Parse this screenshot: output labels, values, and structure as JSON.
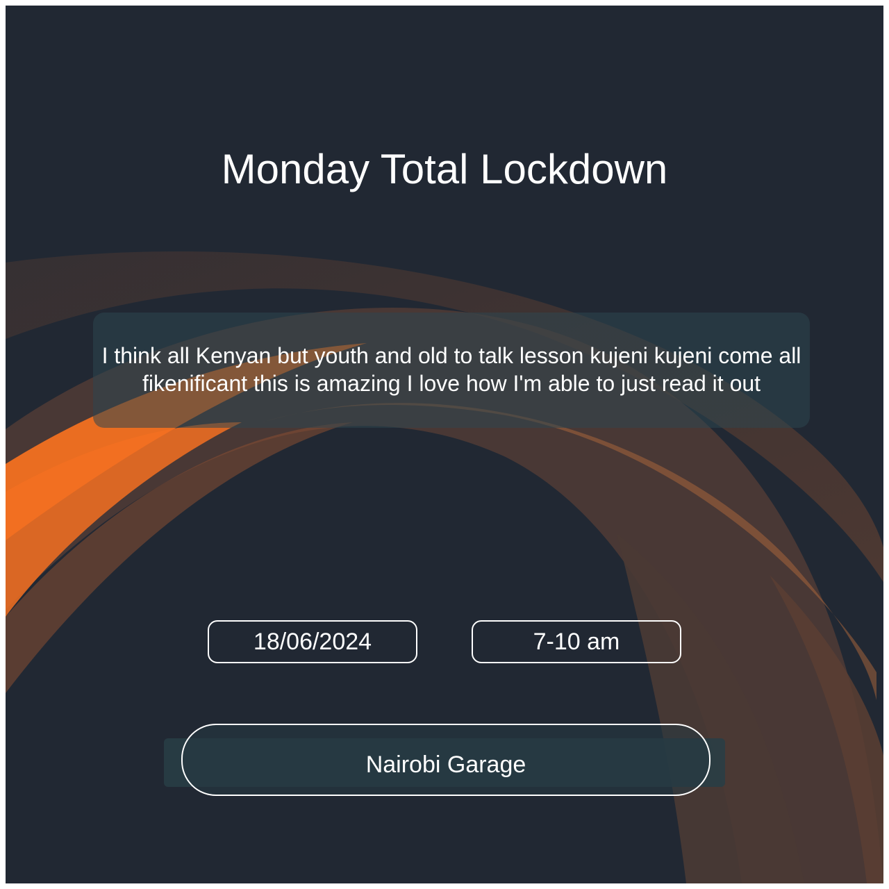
{
  "colors": {
    "background": "#212833",
    "accent_orange": "#f37021",
    "accent_brown": "#6b4636",
    "text": "#ffffff"
  },
  "event": {
    "title": "Monday Total Lockdown",
    "message": "I think all Kenyan but youth and old to talk lesson kujeni kujeni come all fikenificant this is amazing I love how I'm able to just read it out",
    "date": "18/06/2024",
    "time": "7-10 am",
    "venue": "Nairobi Garage"
  }
}
